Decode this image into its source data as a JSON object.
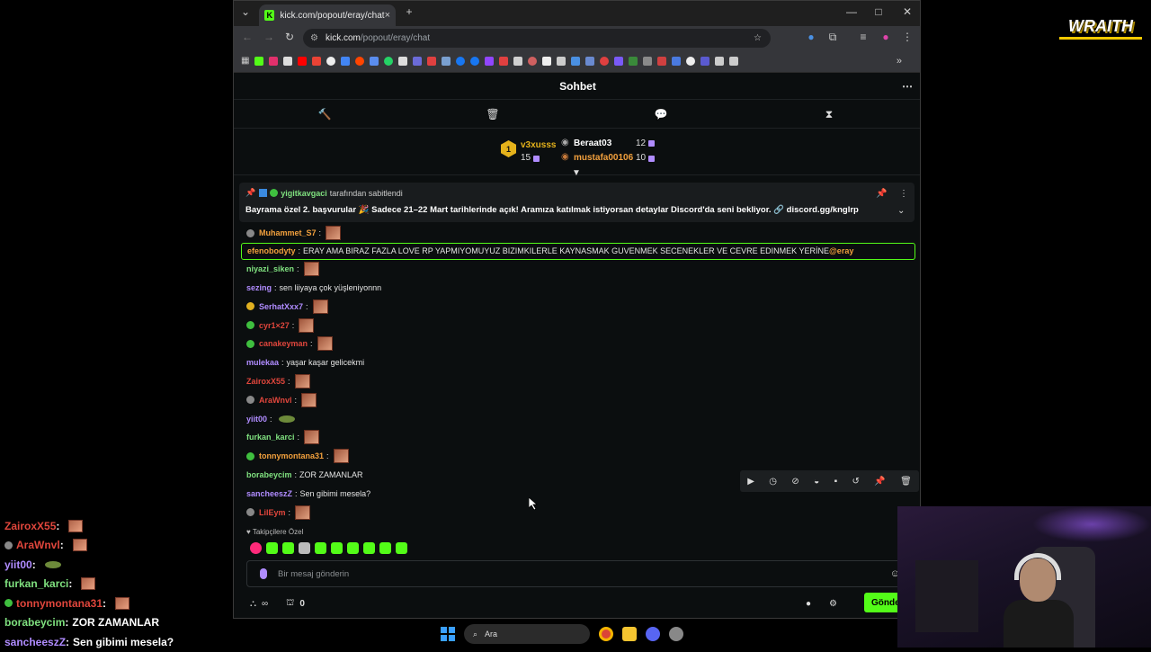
{
  "logo": {
    "text": "WRAITH"
  },
  "overlay": [
    {
      "user": "ZairoxX55",
      "sep": " :",
      "text": "",
      "emote": true,
      "color": "#e0463c"
    },
    {
      "user": "AraWnvl",
      "sep": " :",
      "text": "",
      "emote": true,
      "color": "#e0463c",
      "mod": true
    },
    {
      "user": "yiit00",
      "sep": " :",
      "text": "",
      "frog": true,
      "color": "#b08cff"
    },
    {
      "user": "furkan_karci",
      "sep": " :",
      "text": "",
      "emote": true,
      "color": "#7fe07f"
    },
    {
      "user": "tonnymontana31",
      "sep": " :",
      "text": "",
      "emote": true,
      "color": "#e0463c",
      "green": true
    },
    {
      "user": "borabeycim",
      "sep": " :",
      "text": "ZOR ZAMANLAR",
      "color": "#7fe07f"
    },
    {
      "user": "sancheeszZ",
      "sep": " :",
      "text": "Sen gibimi mesela?",
      "color": "#b08cff"
    }
  ],
  "browser": {
    "tab_title": "kick.com/popout/eray/chat",
    "tab_close": "×",
    "new_tab": "+",
    "url_host": "kick.com",
    "url_path": "/popout/eray/chat",
    "favicon_letter": "K"
  },
  "chat": {
    "header_title": "Sohbet",
    "menu": "⋯",
    "leaderboard": {
      "rank": "1",
      "top_user": "v3xusss",
      "top_count": "15",
      "second_user": "Beraat03",
      "second_count": "12",
      "third_user": "mustafa00106",
      "third_count": "10"
    },
    "pinned": {
      "by_user": "yigitkavgaci",
      "by_text": "tarafından sabitlendi",
      "message": "Bayrama özel 2. başvurular 🎉 Sadece 21–22 Mart tarihlerinde açık! Aramıza katılmak istiyorsan detaylar Discord'da seni bekliyor. 🔗 discord.gg/knglrp"
    },
    "messages": [
      {
        "user": "Muhammet_S7",
        "text": "",
        "color": "#f2a03d",
        "badge": "mod",
        "emote": true
      },
      {
        "user": "efenobodyty",
        "text": "ERAY AMA BIRAZ FAZLA LOVE RP YAPMIYOMUYUZ BIZIMKILERLE KAYNASMAK GUVENMEK SECENEKLER VE CEVRE EDINMEK YERİNE ",
        "mention": "@eray",
        "color": "#f2a03d",
        "highlight": true
      },
      {
        "user": "niyazi_siken",
        "text": "",
        "color": "#7fe07f",
        "emote": true
      },
      {
        "user": "sezing",
        "text": "sen liiyaya çok yüşleniyonnn",
        "color": "#b08cff"
      },
      {
        "user": "SerhatXxx7",
        "text": "",
        "color": "#b08cff",
        "badge": "gift",
        "emote": true
      },
      {
        "user": "cyr1×27",
        "text": "",
        "color": "#e0463c",
        "badge": "green",
        "emote": true
      },
      {
        "user": "canakeyman",
        "text": "",
        "color": "#e0463c",
        "badge": "green",
        "emote": true
      },
      {
        "user": "mulekaa",
        "text": "yaşar kaşar gelicekmi",
        "color": "#b08cff"
      },
      {
        "user": "ZairoxX55",
        "text": "",
        "color": "#e0463c",
        "emote": true
      },
      {
        "user": "AraWnvl",
        "text": "",
        "color": "#e0463c",
        "badge": "mod",
        "emote": true
      },
      {
        "user": "yiit00",
        "text": "",
        "color": "#b08cff",
        "frog": true
      },
      {
        "user": "furkan_karci",
        "text": "",
        "color": "#7fe07f",
        "emote": true
      },
      {
        "user": "tonnymontana31",
        "text": "",
        "color": "#f2a03d",
        "badge": "green",
        "emote": true
      },
      {
        "user": "borabeycim",
        "text": "ZOR ZAMANLAR",
        "color": "#7fe07f"
      },
      {
        "user": "sancheeszZ",
        "text": "Sen gibimi mesela?",
        "color": "#b08cff"
      },
      {
        "user": "LilEym",
        "text": "",
        "color": "#e0463c",
        "badge": "mod",
        "emote": true
      }
    ],
    "emote_section_label": "♥ Takipçilere Özel",
    "input_placeholder": "Bir mesaj gönderin",
    "points": "0",
    "send_label": "Gönder"
  },
  "taskbar": {
    "search_label": "Ara"
  },
  "colors": {
    "kick_green": "#53fc18",
    "bg": "#0b0e0f"
  }
}
